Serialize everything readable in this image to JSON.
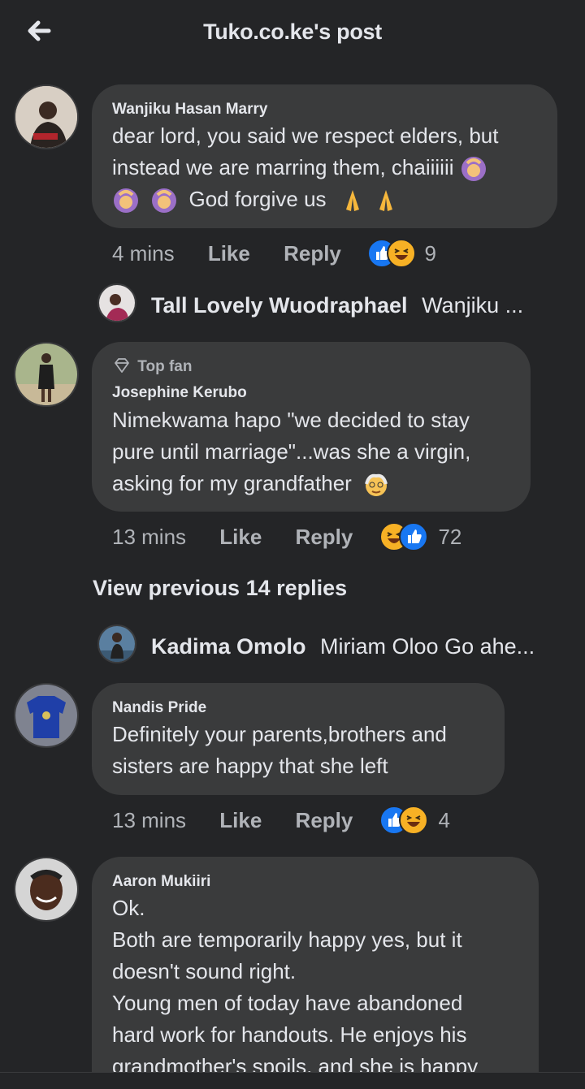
{
  "header": {
    "title": "Tuko.co.ke's post",
    "back_icon": "arrow-left-icon"
  },
  "comments": [
    {
      "author": "Wanjiku Hasan Marry",
      "lines": [
        "dear lord, you said we respect elders, but",
        "instead we are marring them, chaiiiiii",
        "God forgive us"
      ],
      "time": "4 mins",
      "like": "Like",
      "reply": "Reply",
      "reaction_count": "9"
    },
    {
      "badge": "Top fan",
      "author": "Josephine Kerubo",
      "lines": [
        "Nimekwama hapo \"we decided to stay",
        "pure until marriage\"...was she a virgin,",
        "asking for my grandfather"
      ],
      "time": "13 mins",
      "like": "Like",
      "reply": "Reply",
      "reaction_count": "72"
    },
    {
      "author": "Nandis Pride",
      "lines": [
        "Definitely your parents,brothers and",
        "sisters are happy that she left"
      ],
      "time": "13 mins",
      "like": "Like",
      "reply": "Reply",
      "reaction_count": "4"
    },
    {
      "author": "Aaron Mukiiri",
      "lines": [
        "Ok.",
        "Both are temporarily happy yes, but it",
        "doesn't sound right.",
        "Young men of today have abandoned",
        "hard work for handouts. He enjoys his",
        "grandmother's spoils, and she is happy"
      ]
    }
  ],
  "replies": [
    {
      "name": "Tall Lovely Wuodraphael",
      "preview": "Wanjiku ..."
    },
    {
      "name": "Kadima Omolo",
      "preview": "Miriam Oloo Go ahe..."
    }
  ],
  "view_previous": "View previous 14 replies",
  "colors": {
    "background": "#242527",
    "bubble": "#3a3b3c",
    "like_blue": "#1877f2",
    "haha_yellow": "#f7b125"
  }
}
